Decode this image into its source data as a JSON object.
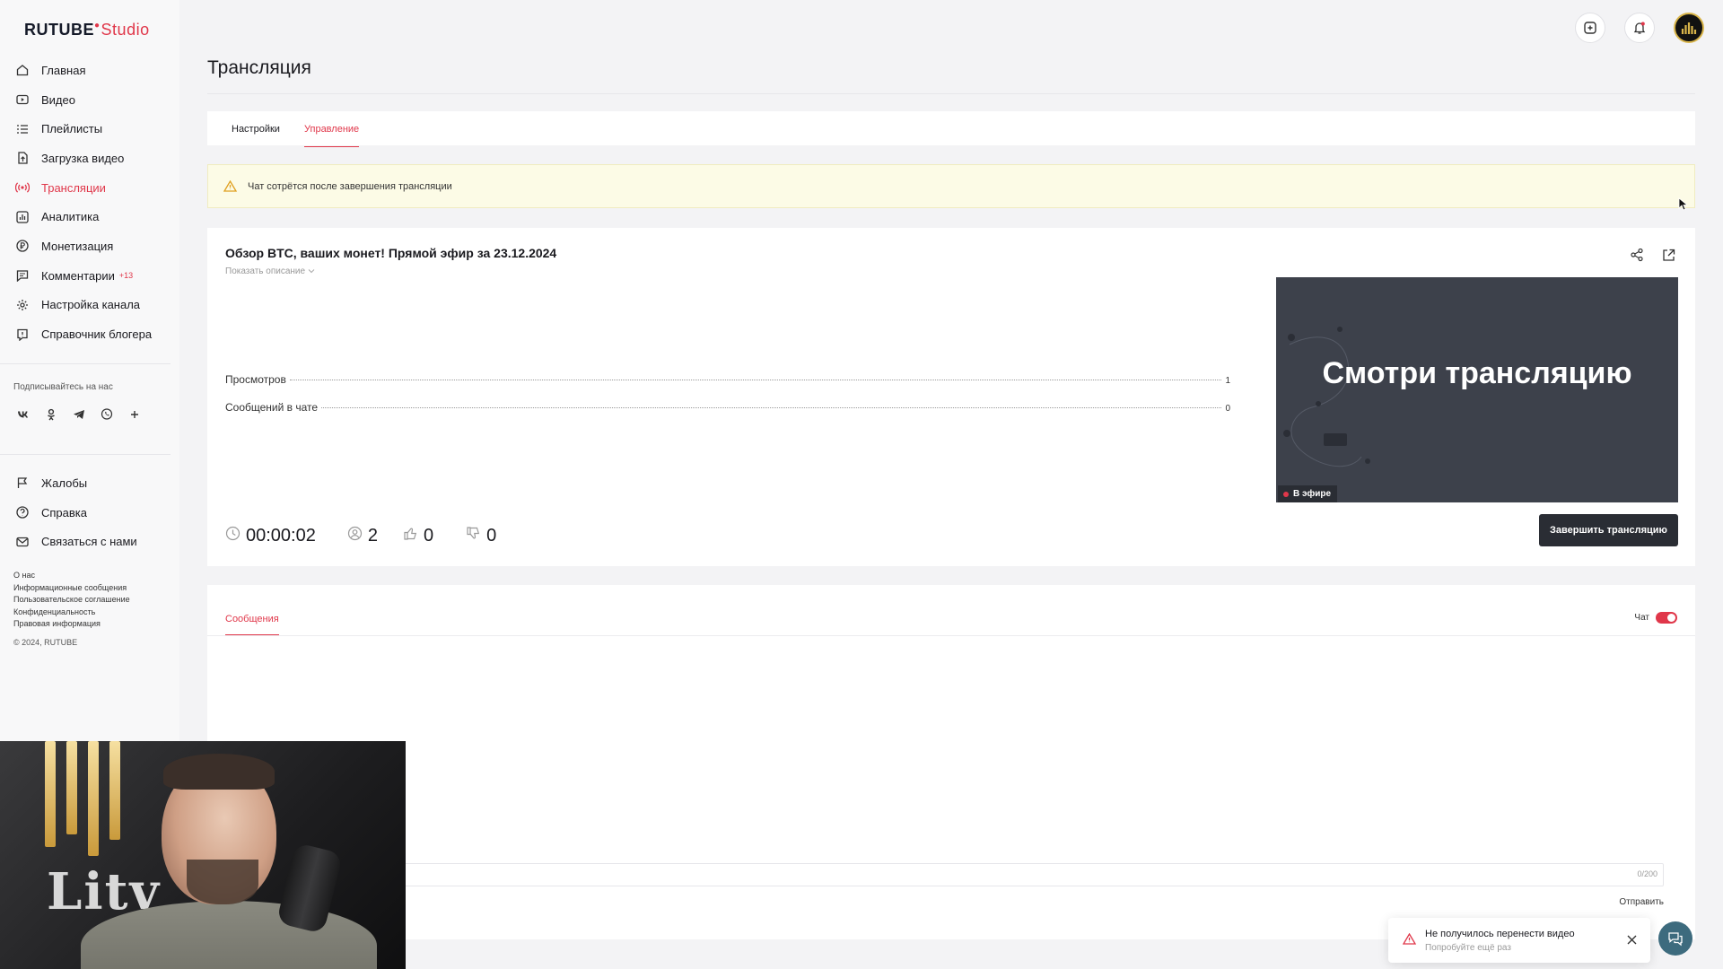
{
  "brand": {
    "logo": "RUTUBE",
    "studio": "Studio",
    "accent": "#e0374a"
  },
  "sidebar": {
    "items": [
      {
        "label": "Главная",
        "icon": "home-icon"
      },
      {
        "label": "Видео",
        "icon": "video-icon"
      },
      {
        "label": "Плейлисты",
        "icon": "playlist-icon"
      },
      {
        "label": "Загрузка видео",
        "icon": "upload-icon"
      },
      {
        "label": "Трансляции",
        "icon": "broadcast-icon",
        "active": true
      },
      {
        "label": "Аналитика",
        "icon": "analytics-icon"
      },
      {
        "label": "Монетизация",
        "icon": "monetization-icon"
      },
      {
        "label": "Комментарии",
        "icon": "comments-icon",
        "badge": "+13"
      },
      {
        "label": "Настройка канала",
        "icon": "gear-icon"
      },
      {
        "label": "Справочник блогера",
        "icon": "info-icon"
      }
    ],
    "follow_label": "Подписывайтесь на нас",
    "socials": [
      "vk-icon",
      "ok-icon",
      "telegram-icon",
      "viber-icon",
      "plus-icon"
    ],
    "secondary_items": [
      {
        "label": "Жалобы",
        "icon": "flag-icon"
      },
      {
        "label": "Справка",
        "icon": "help-icon"
      },
      {
        "label": "Связаться с нами",
        "icon": "mail-icon"
      }
    ],
    "footer_links": [
      "О нас",
      "Информационные сообщения",
      "Пользовательское соглашение",
      "Конфиденциальность",
      "Правовая информация"
    ],
    "copyright": "© 2024, RUTUBE"
  },
  "header": {
    "title": "Трансляция"
  },
  "tabs": {
    "settings": "Настройки",
    "manage": "Управление"
  },
  "warning": {
    "text": "Чат сотрётся после завершения трансляции"
  },
  "stream": {
    "title": "Обзор BTC, ваших монет! Прямой эфир за 23.12.2024",
    "show_description": "Показать описание",
    "stats": [
      {
        "label": "Просмотров",
        "value": "1"
      },
      {
        "label": "Сообщений в чате",
        "value": "0"
      }
    ],
    "timer": "00:00:02",
    "viewers": "2",
    "likes": "0",
    "dislikes": "0",
    "preview_text": "Смотри трансляцию",
    "live_label": "В эфире",
    "end_button": "Завершить трансляцию"
  },
  "chat": {
    "tab_label": "Сообщения",
    "toggle_label": "Чат",
    "char_counter": "0/200",
    "send_label": "Отправить"
  },
  "toast": {
    "title": "Не получилось перенести видео",
    "subtitle": "Попробуйте ещё раз"
  },
  "webcam": {
    "lettering": "Litv"
  }
}
